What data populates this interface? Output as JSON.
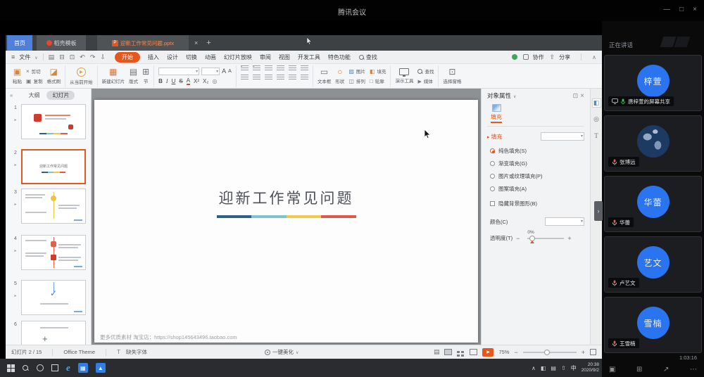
{
  "colors": {
    "accent": "#e4581f",
    "tab_blue": "#4f7fd8",
    "avatar_blue": "#2b74ef",
    "canvas": "#8e9194",
    "taskbar": "#2b2c2f",
    "sidebar_bg": "#0a0a0b",
    "tile_bg": "#1c1d20",
    "green": "#3aa857",
    "line_a": "#2e5f8a",
    "line_b": "#7cc5c8",
    "line_c": "#f2c94c",
    "line_d": "#e2574d"
  },
  "meeting": {
    "title": "腾讯会议",
    "controls": {
      "min": "—",
      "max": "□",
      "close": "×"
    },
    "sidebar": {
      "header": "正在讲话",
      "timer": "1:03:16",
      "participants": [
        {
          "avatar": "梓萱",
          "label": "唐梓萱的屏幕共享"
        },
        {
          "avatar": "",
          "label": "张博远"
        },
        {
          "avatar": "华蕾",
          "label": "华蕾"
        },
        {
          "avatar": "艺文",
          "label": "卢艺文"
        },
        {
          "avatar": "雪楠",
          "label": "王雪楠"
        }
      ]
    }
  },
  "wps": {
    "tabs": {
      "home": "首页",
      "docer": "稻壳模板",
      "doc": "迎新工作常见问题.pptx",
      "doc_icon": "P",
      "close": "×",
      "add": "+"
    },
    "menubar": {
      "file": "文件",
      "items": [
        "开始",
        "插入",
        "设计",
        "切换",
        "动画",
        "幻灯片放映",
        "审阅",
        "视图",
        "开发工具",
        "特色功能"
      ],
      "find": "查找",
      "collab": "协作",
      "share": "分享"
    },
    "ribbon": {
      "paste": "粘贴",
      "cut": "剪切",
      "copy": "复制",
      "painter": "格式刷",
      "play": "从当前开始",
      "new_slide": "新建幻灯片",
      "layout": "版式",
      "section": "节",
      "bold": "B",
      "italic": "I",
      "underline": "U",
      "strike": "S",
      "fontcolor": "A",
      "x_sup": "X²",
      "x_sub": "X₂",
      "textbox": "文本框",
      "shape": "形状",
      "picture": "图片",
      "fill": "填充",
      "arrange": "排列",
      "outline": "轮廓",
      "tools": "演示工具",
      "find": "查找",
      "media": "媒体",
      "select_pane": "选择窗格"
    },
    "panel": {
      "outline_tab": "大纲",
      "slides_tab": "幻灯片",
      "numbers": [
        "1",
        "2",
        "3",
        "4",
        "5",
        "6"
      ],
      "add": "+"
    },
    "slide": {
      "title": "迎新工作常见问题"
    },
    "watermark": "更多优质素材 淘宝店：https://shop145643496.taobao.com",
    "props": {
      "title": "对象属性",
      "tab": "填充",
      "section": "填充",
      "opt_solid": "纯色填充(S)",
      "opt_gradient": "渐变填充(G)",
      "opt_texture": "图片或纹理填充(P)",
      "opt_pattern": "图案填充(A)",
      "opt_hide": "隐藏背景图形(B)",
      "color": "颜色(C)",
      "transparency": "透明度(T)",
      "trans_value": "0%"
    },
    "status": {
      "slide_info": "幻灯片 2 / 15",
      "theme": "Office Theme",
      "missing_font": "缺失字体",
      "beautify": "一键美化",
      "zoom": "75%"
    }
  },
  "taskbar": {
    "ime": "中",
    "time": "20:38",
    "date": "2020/9/2"
  }
}
